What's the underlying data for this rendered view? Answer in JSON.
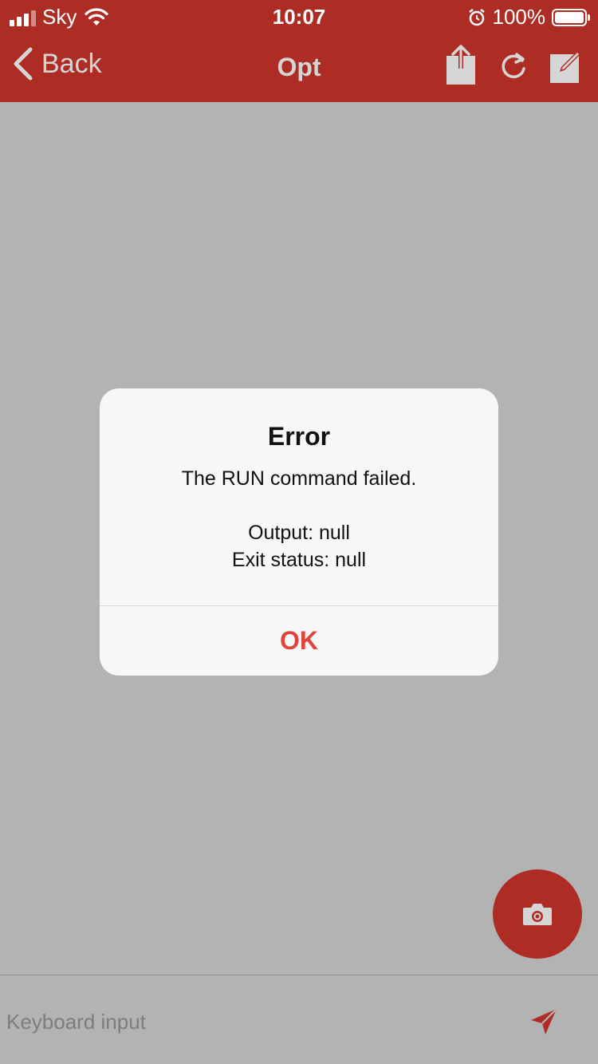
{
  "status_bar": {
    "carrier": "Sky",
    "time": "10:07",
    "battery_percent": "100%",
    "signal_bars_filled": 3,
    "signal_bars_total": 4
  },
  "nav": {
    "back_label": "Back",
    "title": "Opt",
    "actions": [
      "share-icon",
      "refresh-icon",
      "edit-icon"
    ]
  },
  "alert": {
    "title": "Error",
    "message_line1": "The RUN command failed.",
    "output_line": "Output: null",
    "exit_line": "Exit status: null",
    "ok_label": "OK"
  },
  "input": {
    "placeholder": "Keyboard input",
    "value": ""
  },
  "colors": {
    "brand_red": "#ad2d24",
    "alert_button": "#e0433a",
    "overlay_gray": "#b3b3b3"
  }
}
